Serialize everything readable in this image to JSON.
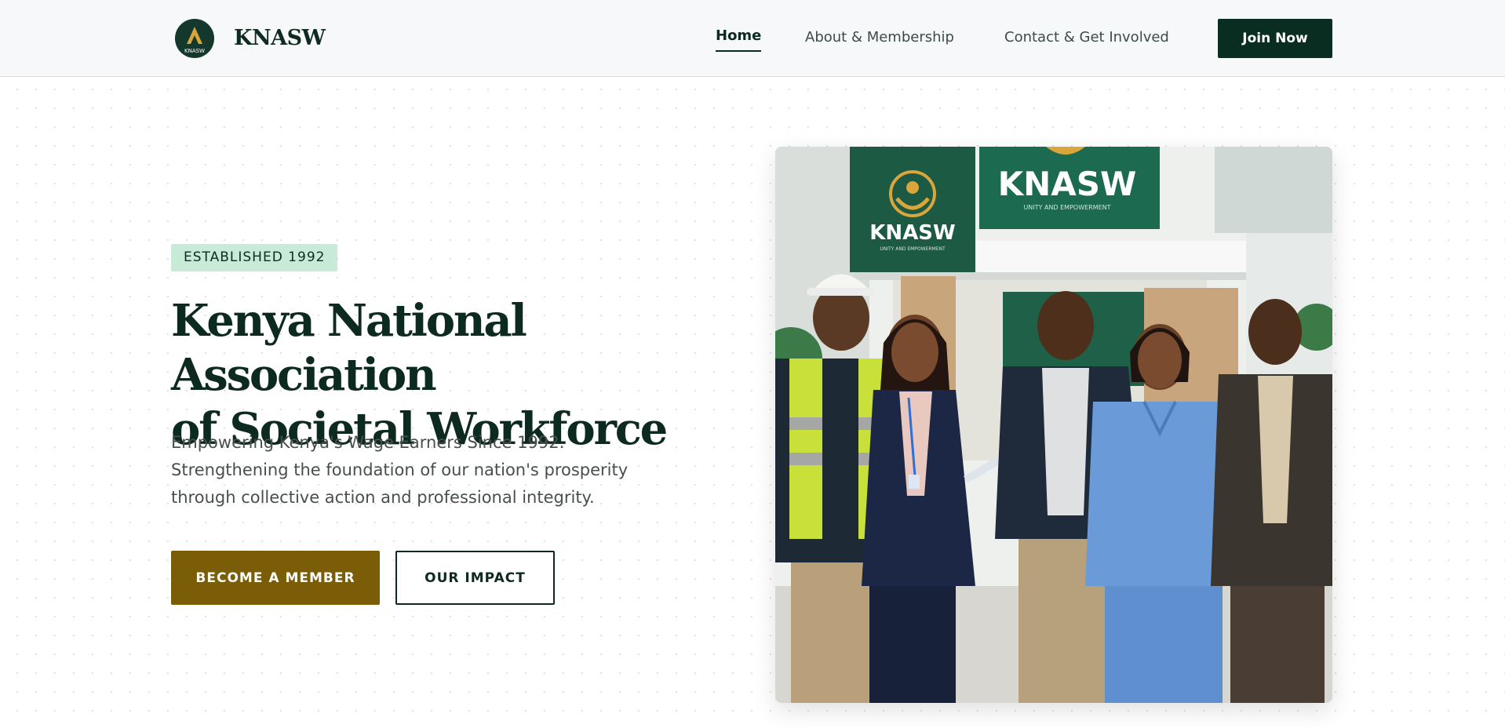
{
  "brand": {
    "name": "KNASW",
    "logo_text": "KNASW",
    "logo_icon": "mountain-icon",
    "colors": {
      "primary": "#0a2d21",
      "accent": "#7b5c07",
      "gold": "#d8a63a",
      "badge_bg": "#c7ebd7"
    }
  },
  "nav": {
    "links": [
      {
        "label": "Home",
        "active": true
      },
      {
        "label": "About & Membership",
        "active": false
      },
      {
        "label": "Contact & Get Involved",
        "active": false
      }
    ],
    "cta_label": "Join Now"
  },
  "hero": {
    "badge": "ESTABLISHED 1992",
    "title_line1": "Kenya National Association",
    "title_line2": "of Societal Workforce",
    "subtitle": "Empowering Kenya's Wage Earners Since 1992. Strengthening the foundation of our nation's prosperity through collective action and professional integrity.",
    "primary_cta": "BECOME A MEMBER",
    "secondary_cta": "OUR IMPACT"
  },
  "photo": {
    "banner_left": "KNASW",
    "banner_left_small": "UNITY AND EMPOWERMENT",
    "banner_right": "KNASW",
    "banner_right_small": "UNITY AND EMPOWERMENT"
  }
}
